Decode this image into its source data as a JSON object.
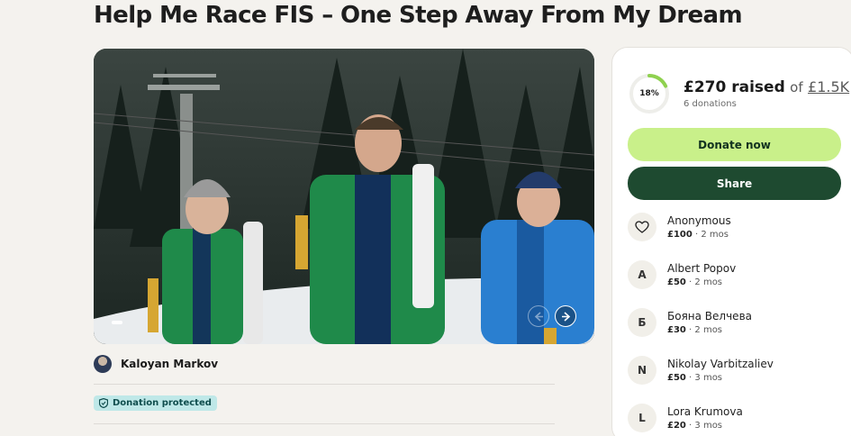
{
  "campaign": {
    "title": "Help Me Race FIS – One Step Away From My Dream",
    "organizer": "Kaloyan Markov",
    "protected_label": "Donation protected"
  },
  "funding": {
    "percent_label": "18%",
    "percent": 0.18,
    "raised": "£270 raised",
    "of": "of",
    "goal": "£1.5K",
    "donations": "6 donations"
  },
  "buttons": {
    "donate": "Donate now",
    "share": "Share"
  },
  "donors": [
    {
      "name": "Anonymous",
      "amount": "£100",
      "time": " · 2 mos",
      "initial": ""
    },
    {
      "name": "Albert Popov",
      "amount": "£50",
      "time": " · 2 mos",
      "initial": "A"
    },
    {
      "name": "Бояна Велчева",
      "amount": "£30",
      "time": " · 2 mos",
      "initial": "Б"
    },
    {
      "name": "Nikolay Varbitzaliev",
      "amount": "£50",
      "time": " · 3 mos",
      "initial": "N"
    },
    {
      "name": "Lora Krumova",
      "amount": "£20",
      "time": " · 3 mos",
      "initial": "L"
    }
  ],
  "colors": {
    "accent_green": "#c9f08a",
    "dark_green": "#1e4a30",
    "protected_bg": "#bfe8e8",
    "progress": "#8fd14f"
  },
  "icons": {
    "prev": "arrow-left-icon",
    "next": "arrow-right-icon",
    "shield": "shield-icon",
    "heart": "heart-hands-icon"
  }
}
